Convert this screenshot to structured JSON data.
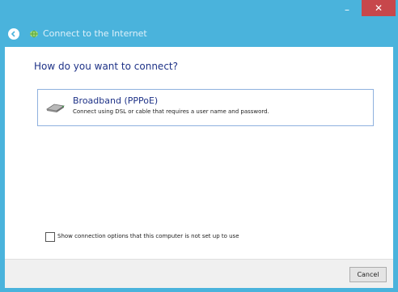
{
  "window": {
    "minimize_glyph": "–",
    "close_glyph": "✕",
    "title": "Connect to the Internet"
  },
  "main": {
    "heading": "How do you want to connect?",
    "options": [
      {
        "title": "Broadband (PPPoE)",
        "description": "Connect using DSL or cable that requires a user name and password.",
        "icon": "broadband-icon"
      }
    ],
    "checkbox_label": "Show connection options that this computer is not set up to use",
    "checkbox_checked": false
  },
  "footer": {
    "cancel_label": "Cancel"
  },
  "colors": {
    "titlebar": "#4ab3dc",
    "close": "#c7474b",
    "heading": "#1e3287",
    "card_border": "#8fb1de"
  }
}
